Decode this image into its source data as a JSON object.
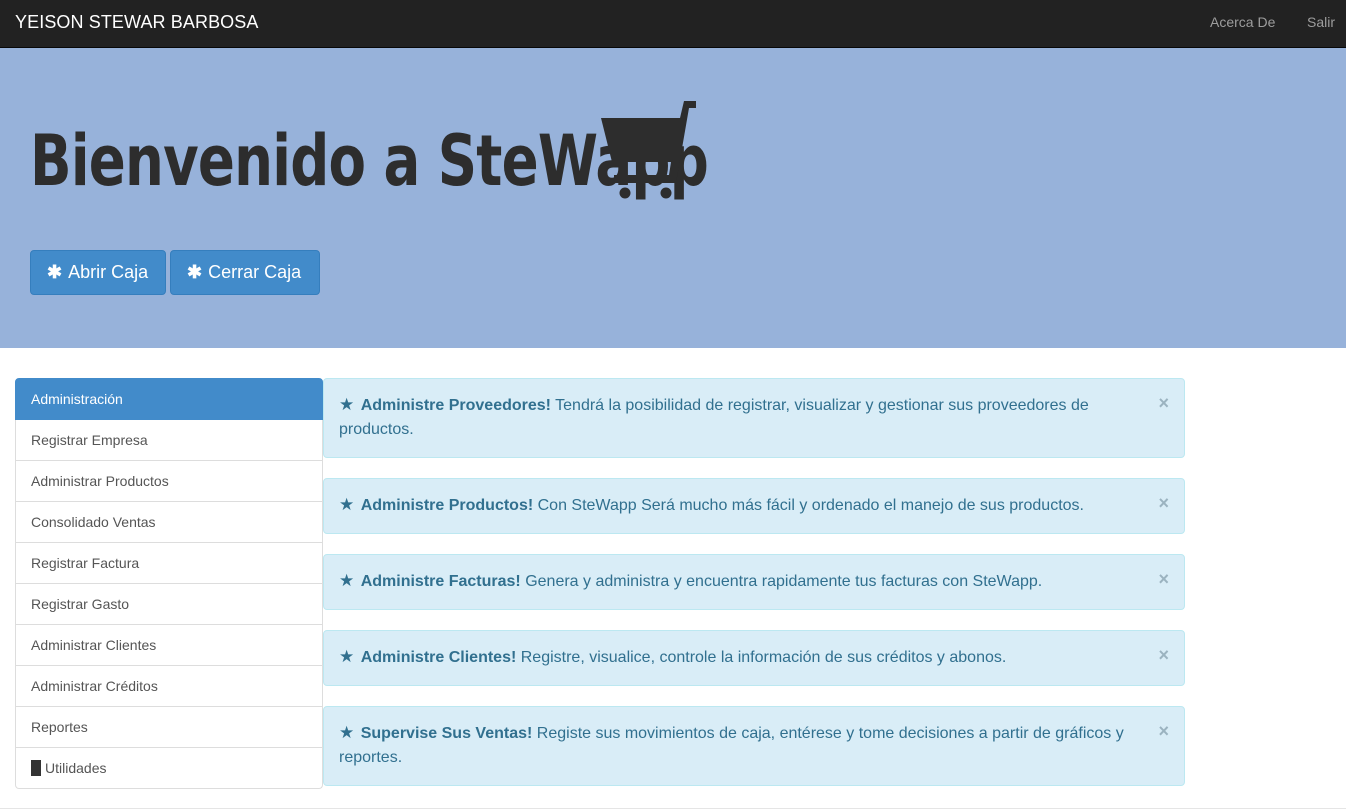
{
  "navbar": {
    "brand": "YEISON STEWAR BARBOSA",
    "links": [
      "Acerca De",
      "Salir"
    ]
  },
  "jumbotron": {
    "title": "Bienvenido a SteWapp",
    "icon": "shopping-cart-icon",
    "buttons": [
      {
        "icon": "asterisk-icon",
        "label": "Abrir Caja"
      },
      {
        "icon": "asterisk-icon",
        "label": "Cerrar Caja"
      }
    ]
  },
  "sidebar": {
    "items": [
      {
        "label": "Administración",
        "active": true
      },
      {
        "label": "Registrar Empresa"
      },
      {
        "label": "Administrar Productos"
      },
      {
        "label": "Consolidado Ventas"
      },
      {
        "label": "Registrar Factura"
      },
      {
        "label": "Registrar Gasto"
      },
      {
        "label": "Administrar Clientes"
      },
      {
        "label": "Administrar Créditos"
      },
      {
        "label": "Reportes"
      },
      {
        "label": "Utilidades",
        "icon": "bar-icon"
      }
    ]
  },
  "alerts": [
    {
      "title": "Administre Proveedores!",
      "text": " Tendrá la posibilidad de registrar, visualizar y gestionar sus proveedores de productos."
    },
    {
      "title": "Administre Productos!",
      "text": " Con SteWapp Será mucho más fácil y ordenado el manejo de sus productos."
    },
    {
      "title": "Administre Facturas!",
      "text": " Genera y administra y encuentra rapidamente tus facturas con SteWapp."
    },
    {
      "title": "Administre Clientes!",
      "text": " Registre, visualice, controle la información de sus créditos y abonos."
    },
    {
      "title": "Supervise Sus Ventas!",
      "text": " Registe sus movimientos de caja, entérese y tome decisiones a partir de gráficos y reportes."
    }
  ],
  "symbols": {
    "star": "★",
    "close": "×",
    "asterisk": "✱"
  },
  "colors": {
    "navbar": "#222222",
    "jumbotron": "#97b2da",
    "primary": "#428bca",
    "alert_bg": "#d9edf7",
    "alert_text": "#31708f"
  }
}
